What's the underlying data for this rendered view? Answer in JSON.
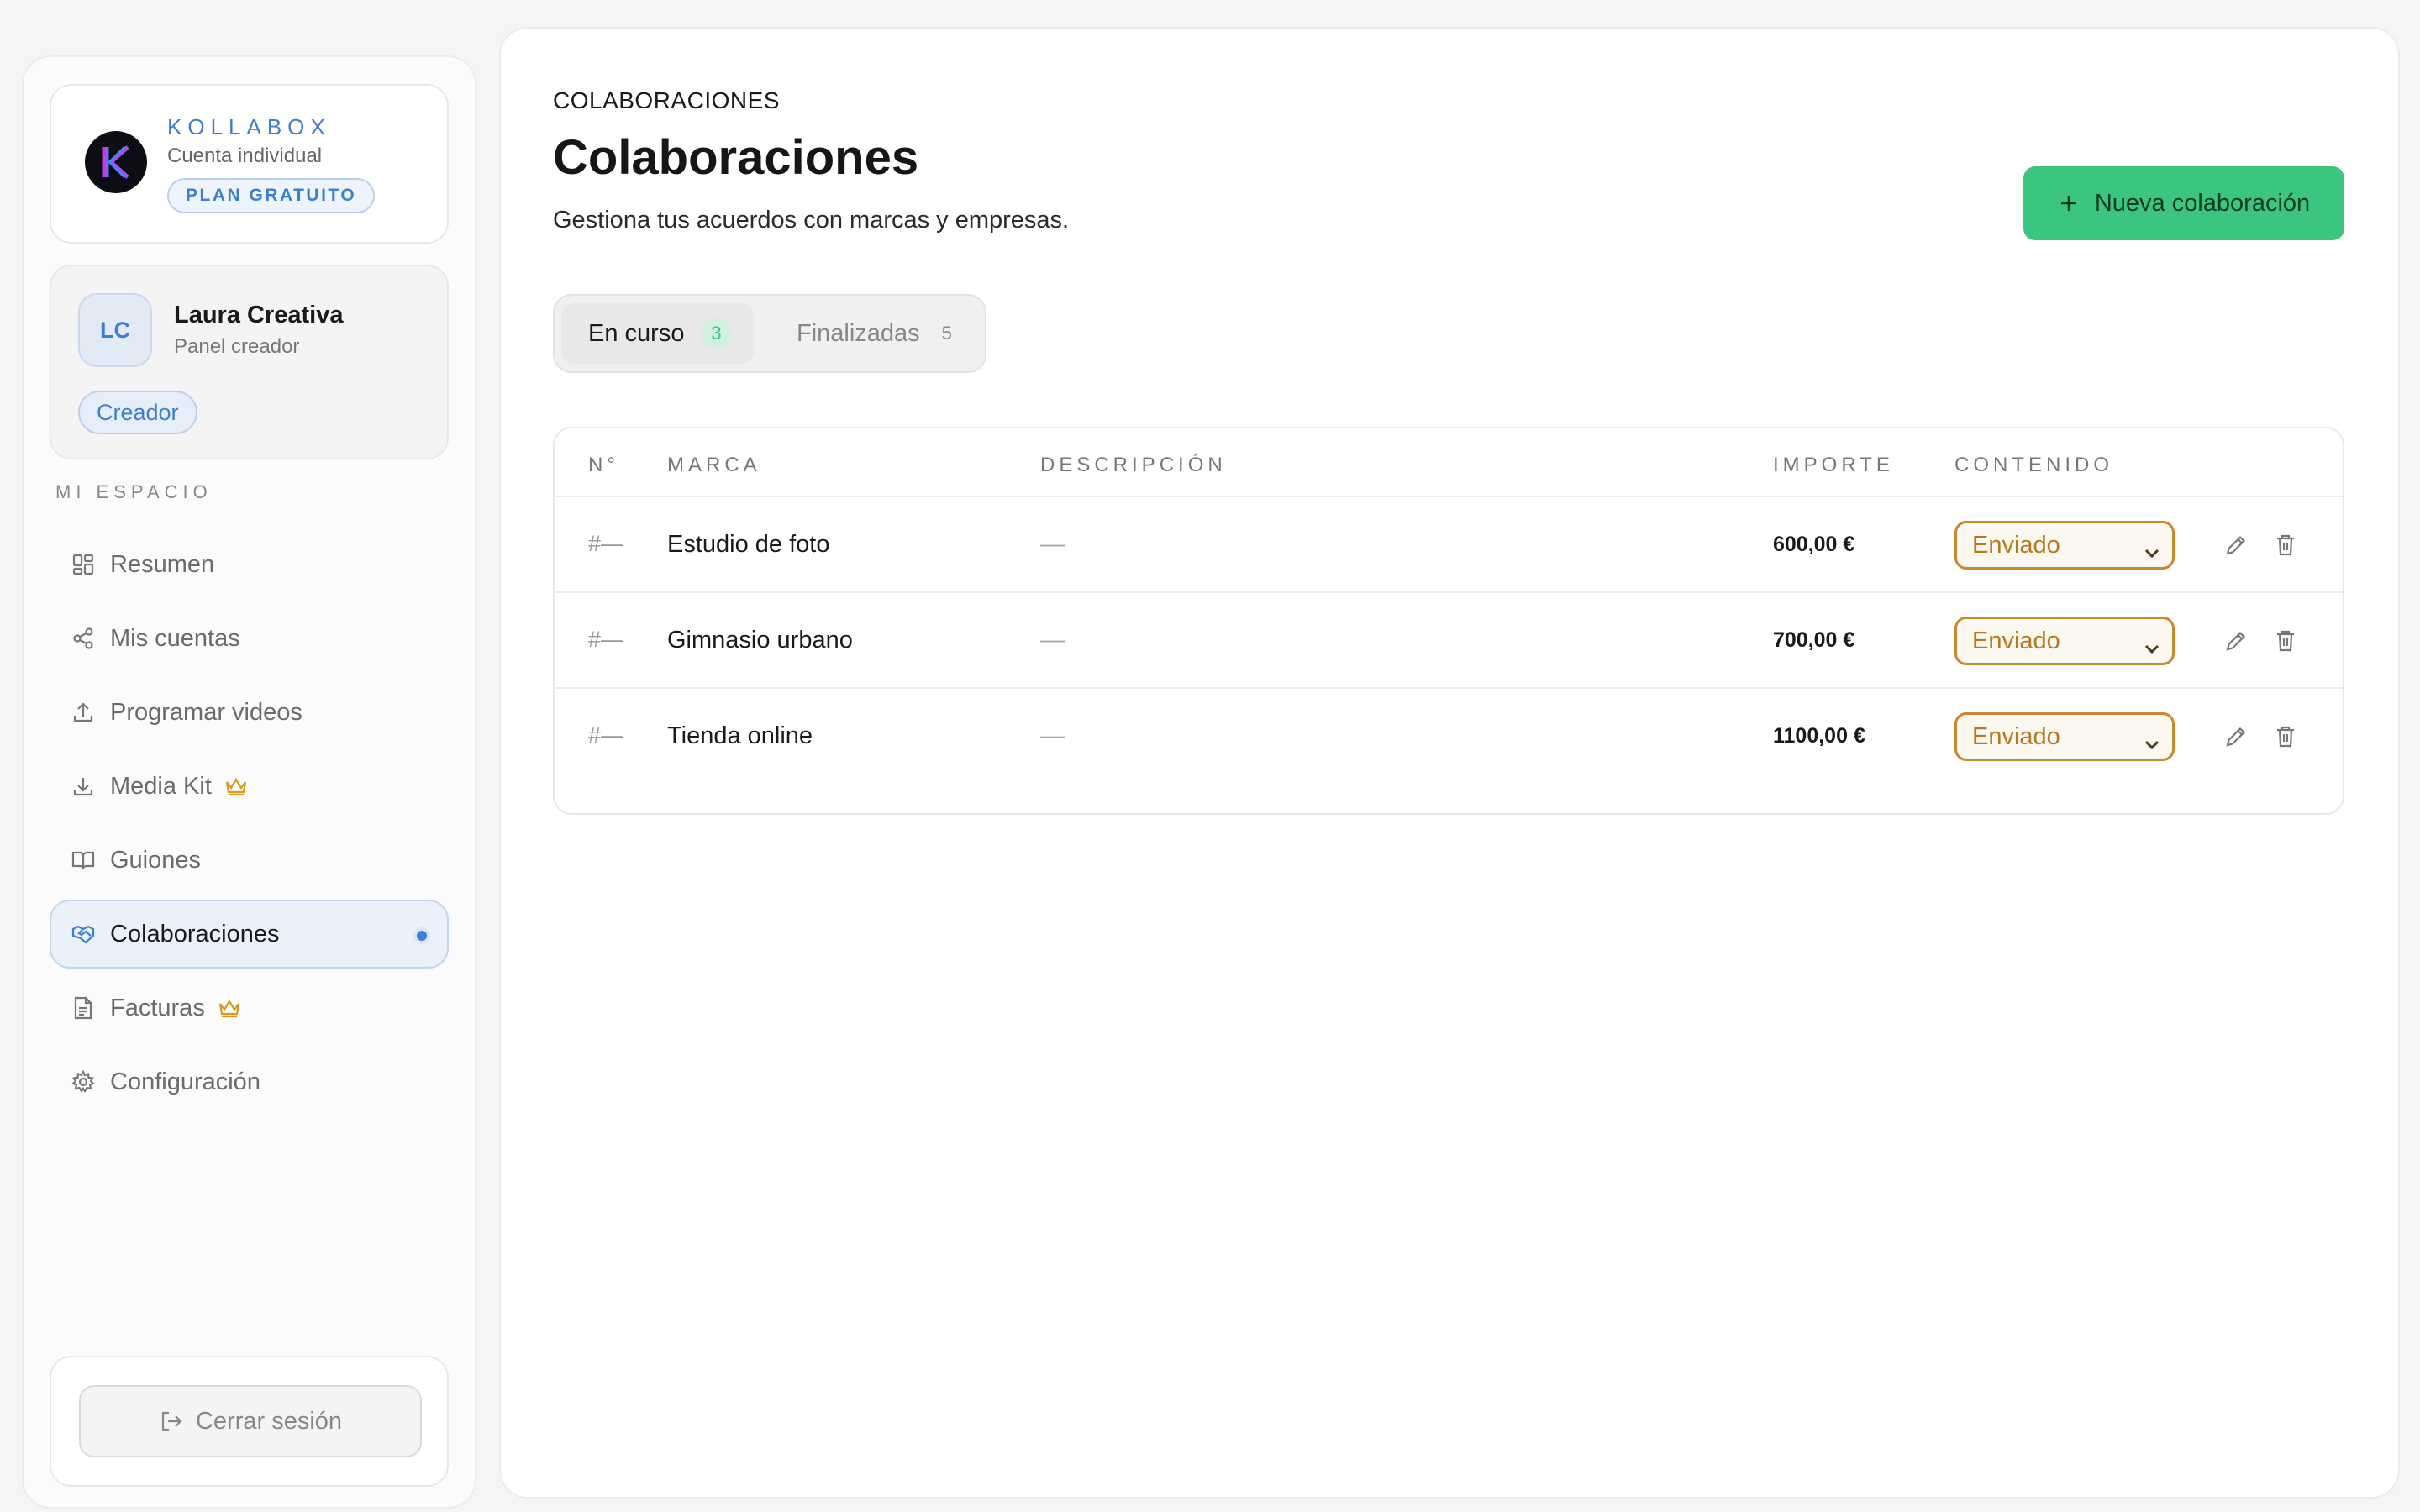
{
  "sidebar": {
    "brand": {
      "name": "KOLLABOX",
      "account_type": "Cuenta individual",
      "plan": "PLAN GRATUITO"
    },
    "user": {
      "initials": "LC",
      "name": "Laura Creativa",
      "subtitle": "Panel creador",
      "role": "Creador"
    },
    "section_label": "MI ESPACIO",
    "nav": [
      {
        "label": "Resumen",
        "icon": "grid-icon"
      },
      {
        "label": "Mis cuentas",
        "icon": "share-icon"
      },
      {
        "label": "Programar videos",
        "icon": "upload-icon"
      },
      {
        "label": "Media Kit",
        "icon": "download-icon",
        "premium": true
      },
      {
        "label": "Guiones",
        "icon": "book-icon"
      },
      {
        "label": "Colaboraciones",
        "icon": "handshake-icon",
        "active": true
      },
      {
        "label": "Facturas",
        "icon": "file-icon",
        "premium": true
      },
      {
        "label": "Configuración",
        "icon": "gear-icon"
      }
    ],
    "logout_label": "Cerrar sesión"
  },
  "main": {
    "breadcrumb": "COLABORACIONES",
    "title": "Colaboraciones",
    "subtitle": "Gestiona tus acuerdos con marcas y empresas.",
    "new_button": "Nueva colaboración",
    "tabs": [
      {
        "label": "En curso",
        "count": "3",
        "active": true
      },
      {
        "label": "Finalizadas",
        "count": "5",
        "active": false
      }
    ],
    "table": {
      "headers": [
        "N°",
        "MARCA",
        "DESCRIPCIÓN",
        "IMPORTE",
        "CONTENIDO"
      ],
      "rows": [
        {
          "num": "#—",
          "brand": "Estudio de foto",
          "description": "—",
          "amount": "600,00 €",
          "status": "Enviado"
        },
        {
          "num": "#—",
          "brand": "Gimnasio urbano",
          "description": "—",
          "amount": "700,00 €",
          "status": "Enviado"
        },
        {
          "num": "#—",
          "brand": "Tienda online",
          "description": "—",
          "amount": "1100,00 €",
          "status": "Enviado"
        }
      ]
    }
  },
  "colors": {
    "accent_blue": "#3d7fcf",
    "accent_green": "#3cc57f",
    "status_amber": "#c9892c",
    "premium_crown": "#d99a1c"
  }
}
